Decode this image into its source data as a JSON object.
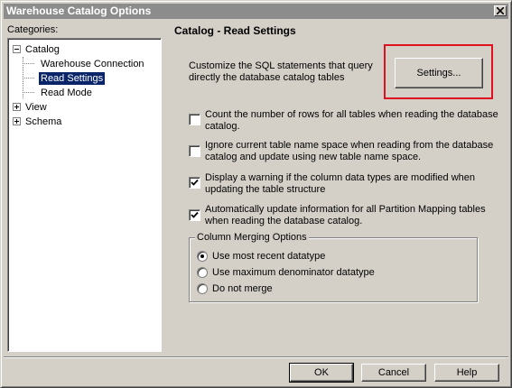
{
  "window": {
    "title": "Warehouse Catalog Options"
  },
  "categories": {
    "label": "Categories:",
    "tree": {
      "catalog": "Catalog",
      "warehouse_connection": "Warehouse Connection",
      "read_settings": "Read Settings",
      "read_mode": "Read Mode",
      "view": "View",
      "schema": "Schema"
    }
  },
  "panel": {
    "title": "Catalog - Read Settings",
    "description_line1": "Customize the SQL statements that query",
    "description_line2": "directly the database catalog tables",
    "settings_button": "Settings..."
  },
  "options": [
    {
      "text": "Count the number of rows for all tables when reading the database catalog.",
      "checked": false
    },
    {
      "text": "Ignore current table name space when reading from the database catalog and update using new table name space.",
      "checked": false
    },
    {
      "text": "Display a warning if the column data types are modified when updating the table structure",
      "checked": true
    },
    {
      "text": "Automatically update information for all Partition Mapping tables when reading the database catalog.",
      "checked": true
    }
  ],
  "column_merging": {
    "legend": "Column Merging Options",
    "options": [
      {
        "label": "Use most recent datatype",
        "selected": true
      },
      {
        "label": "Use maximum denominator datatype",
        "selected": false
      },
      {
        "label": "Do not merge",
        "selected": false
      }
    ]
  },
  "footer": {
    "ok": "OK",
    "cancel": "Cancel",
    "help": "Help"
  },
  "colors": {
    "highlight_box": "#e01020",
    "selection": "#0a246a",
    "titlebar": "#8c8c8c"
  },
  "icons": {
    "close": "close-icon",
    "collapse": "minus-box-icon",
    "expand": "plus-box-icon",
    "check": "checkmark-icon"
  }
}
